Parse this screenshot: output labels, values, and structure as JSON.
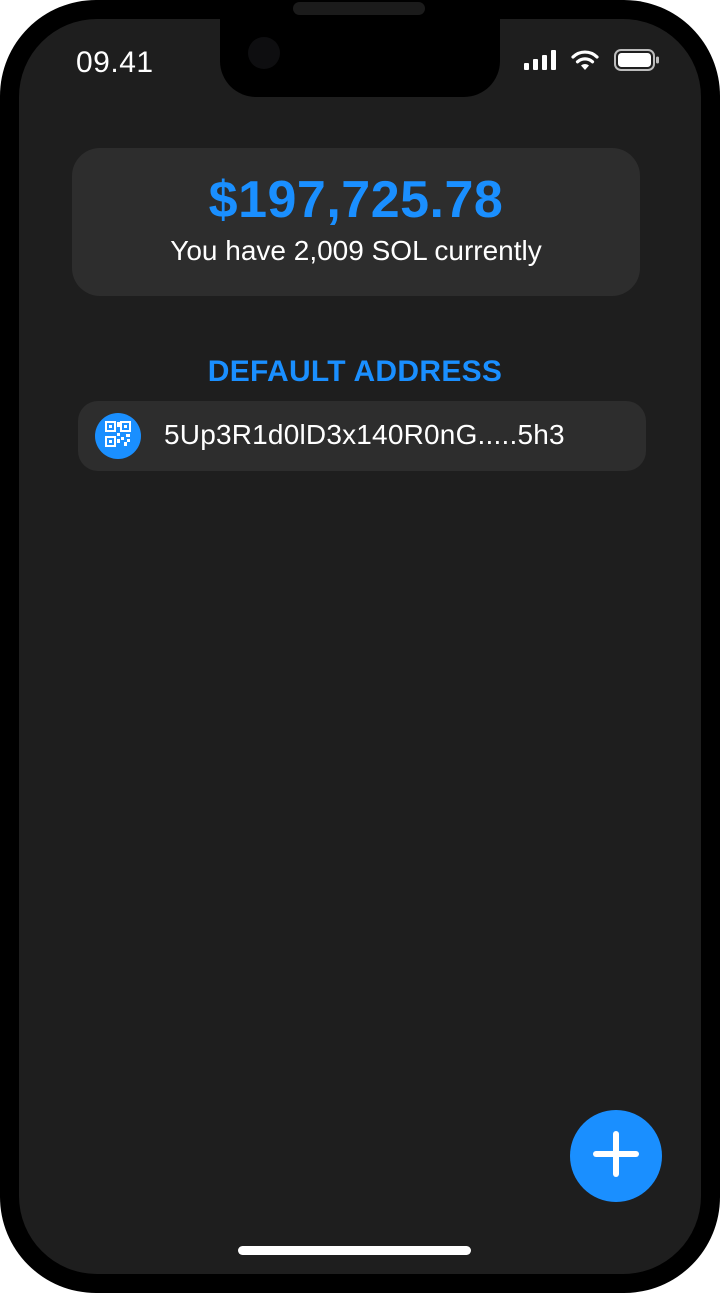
{
  "status_bar": {
    "time": "09.41",
    "icons": [
      "cellular-signal-icon",
      "wifi-icon",
      "battery-icon"
    ]
  },
  "balance": {
    "amount": "$197,725.78",
    "subtitle": "You have 2,009 SOL currently"
  },
  "default_address": {
    "section_title": "DEFAULT ADDRESS",
    "address": "5Up3R1d0lD3x140R0nG.....5h3",
    "icon": "qr-code-icon"
  },
  "fab": {
    "icon": "plus-icon"
  },
  "colors": {
    "accent": "#1a8fff",
    "background": "#1e1e1e",
    "card": "#2d2d2d",
    "text": "#ffffff"
  }
}
